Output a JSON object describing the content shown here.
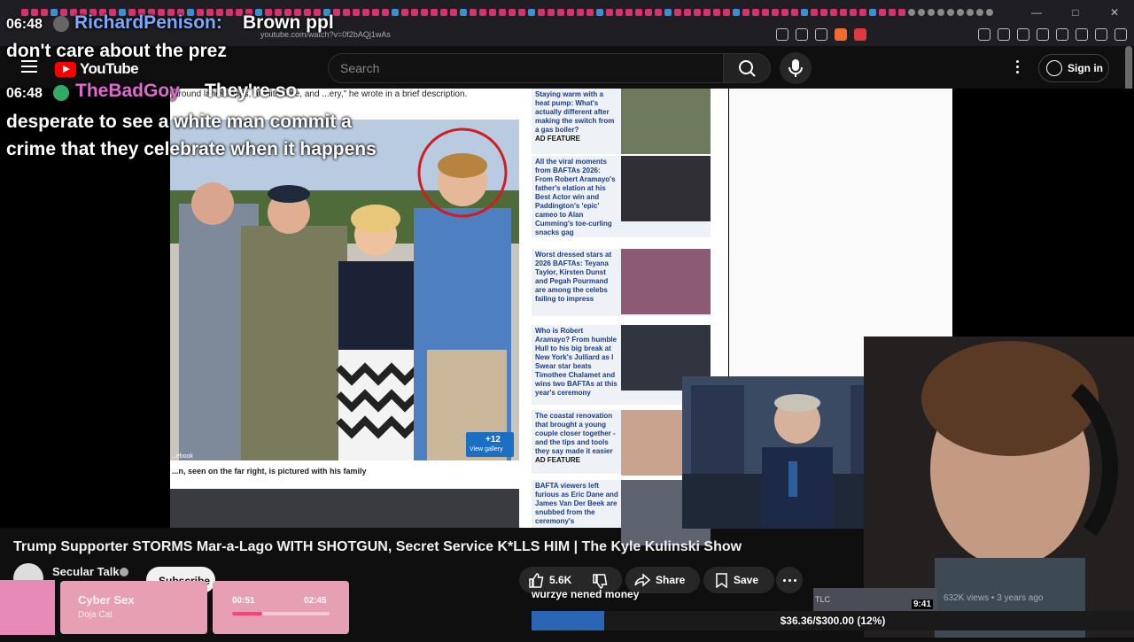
{
  "browser": {
    "url": "youtube.com/watch?v=0f2bAQj1wAs"
  },
  "youtube": {
    "logo_text": "YouTube",
    "search_placeholder": "Search",
    "signin_label": "Sign in"
  },
  "chat": [
    {
      "time": "06:48",
      "user": "RichardPenison",
      "sep": ":",
      "message_part1": "Brown ppl",
      "message_part2": "don't care about the prez"
    },
    {
      "time": "06:48",
      "user": "TheBadGoy",
      "message_part1": "They're so",
      "message_part2": "desperate to see a white man commit a crime that they celebrate when it happens"
    }
  ],
  "article": {
    "intro_text": "around landscapes, architecture, and ...ery,\" he wrote in a brief description.",
    "caption": "...n, seen on the far right, is pictured with his family",
    "photo_credit": "...ebook",
    "gallery_count": "+12",
    "gallery_label": "View gallery",
    "sidebar": [
      {
        "headline": "Staying warm with a heat pump: What's actually different after making the switch from a gas boiler?",
        "tag": "AD FEATURE"
      },
      {
        "headline": "All the viral moments from BAFTAs 2026: From Robert Aramayo's father's elation at his Best Actor win and Paddington's 'epic' cameo to Alan Cumming's toe-curling snacks gag",
        "tag": ""
      },
      {
        "headline": "Worst dressed stars at 2026 BAFTAs: Teyana Taylor, Kirsten Dunst and Pegah Pourmand are among the celebs failing to impress",
        "tag": ""
      },
      {
        "headline": "Who is Robert Aramayo? From humble Hull to his big break at New York's Julliard as I Swear star beats Timothee Chalamet and wins two BAFTAs at this year's ceremony",
        "tag": ""
      },
      {
        "headline": "The coastal renovation that brought a young couple closer together - and the tips and tools they say made it easier",
        "tag": "AD FEATURE"
      },
      {
        "headline": "BAFTA viewers left furious as Eric Dane and James Van Der Beek are snubbed from the ceremony's",
        "tag": ""
      }
    ]
  },
  "video": {
    "title": "Trump Supporter STORMS Mar-a-Lago WITH SHOTGUN, Secret Service K*LLS HIM | The Kyle Kulinski Show",
    "channel": "Secular Talk",
    "subscribe_label": "Subscribe",
    "like_count": "5.6K",
    "share_label": "Share",
    "save_label": "Save"
  },
  "related": {
    "channel_tag": "TLC",
    "duration": "9:41",
    "meta": "632K views • 3 years ago"
  },
  "overlay": {
    "donation_note": "wurzye nened money",
    "goal_text": "$36.36/$300.00 (12%)",
    "goal_fraction": 0.12
  },
  "now_playing": {
    "title": "Cyber Sex",
    "artist": "Doja Cat",
    "elapsed": "00:51",
    "total": "02:45",
    "progress_fraction": 0.31
  },
  "colors": {
    "yt_red": "#ff0000",
    "goal_blue": "#2b66b5",
    "chat_user1": "#7aaaff",
    "chat_user2": "#e06ad0",
    "np_accent": "#ff3f7a"
  }
}
